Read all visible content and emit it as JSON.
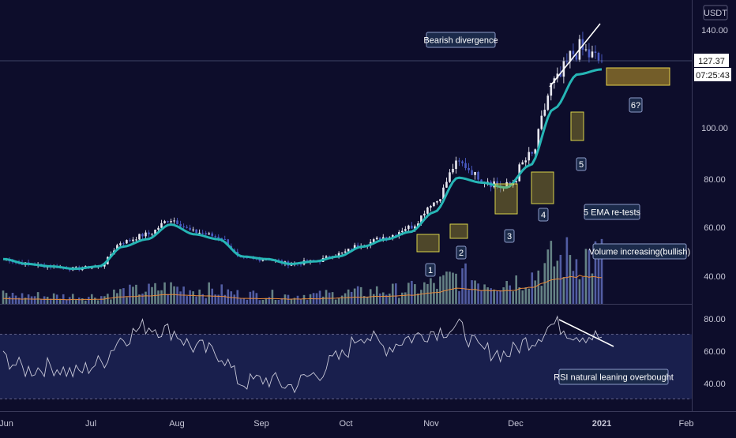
{
  "currency": "USDT",
  "price_axis": {
    "ticks": [
      "140.00",
      "100.00",
      "80.00",
      "60.00",
      "40.00"
    ],
    "last_price": "127.37",
    "countdown": "07:25:43"
  },
  "rsi_axis": {
    "ticks": [
      "80.00",
      "60.00",
      "40.00"
    ]
  },
  "time_axis": {
    "labels": [
      "Jun",
      "Jul",
      "Aug",
      "Sep",
      "Oct",
      "Nov",
      "Dec",
      "2021",
      "Feb"
    ]
  },
  "annotations": {
    "bearish_divergence": "Bearish divergence",
    "target": "6?",
    "ema_retests": "5 EMA re-tests",
    "volume_increasing": "Volume increasing(bullish)",
    "rsi_overbought": "RSI natural leaning overbought",
    "retest_numbers": [
      "1",
      "2",
      "3",
      "4",
      "5"
    ]
  },
  "colors": {
    "background": "#0d0d2b",
    "rsi_band": "#1c2353",
    "candle_up": "#e8e8f0",
    "candle_down": "#4a5bc4",
    "ema": "#26b5b5",
    "volume_ma": "#e8893a",
    "volume_up": "#6f8f8f",
    "volume_down": "#5a66b0",
    "retest_box": "#d8d24a",
    "rsi_line": "#c8c8d8"
  },
  "chart_data": {
    "type": "line",
    "title": "",
    "xlabel": "",
    "ylabel": "",
    "price_ylim": [
      32,
      144
    ],
    "rsi_ylim": [
      25,
      85
    ],
    "rsi_levels": [
      70,
      30
    ],
    "x": [
      "Jun",
      "Jul",
      "Aug",
      "Sep",
      "Oct",
      "Nov",
      "Dec",
      "2021",
      "Feb"
    ],
    "series": [
      {
        "values": [
          47,
          45,
          44,
          43,
          44,
          54,
          57,
          63,
          58,
          56,
          47,
          47,
          45,
          46,
          49,
          53,
          56,
          60,
          70,
          86,
          80,
          76,
          88,
          118,
          132,
          127.37
        ]
      },
      {
        "values": [
          47,
          45,
          44,
          43,
          44,
          52,
          55,
          61,
          57,
          55,
          48,
          47,
          45,
          46,
          48,
          52,
          55,
          58,
          66,
          80,
          78,
          76,
          85,
          108,
          122,
          124
        ]
      },
      {
        "values": [
          55,
          48,
          50,
          46,
          52,
          68,
          75,
          72,
          62,
          58,
          40,
          42,
          38,
          45,
          55,
          70,
          62,
          68,
          72,
          74,
          60,
          58,
          66,
          76,
          70,
          68
        ]
      }
    ]
  }
}
